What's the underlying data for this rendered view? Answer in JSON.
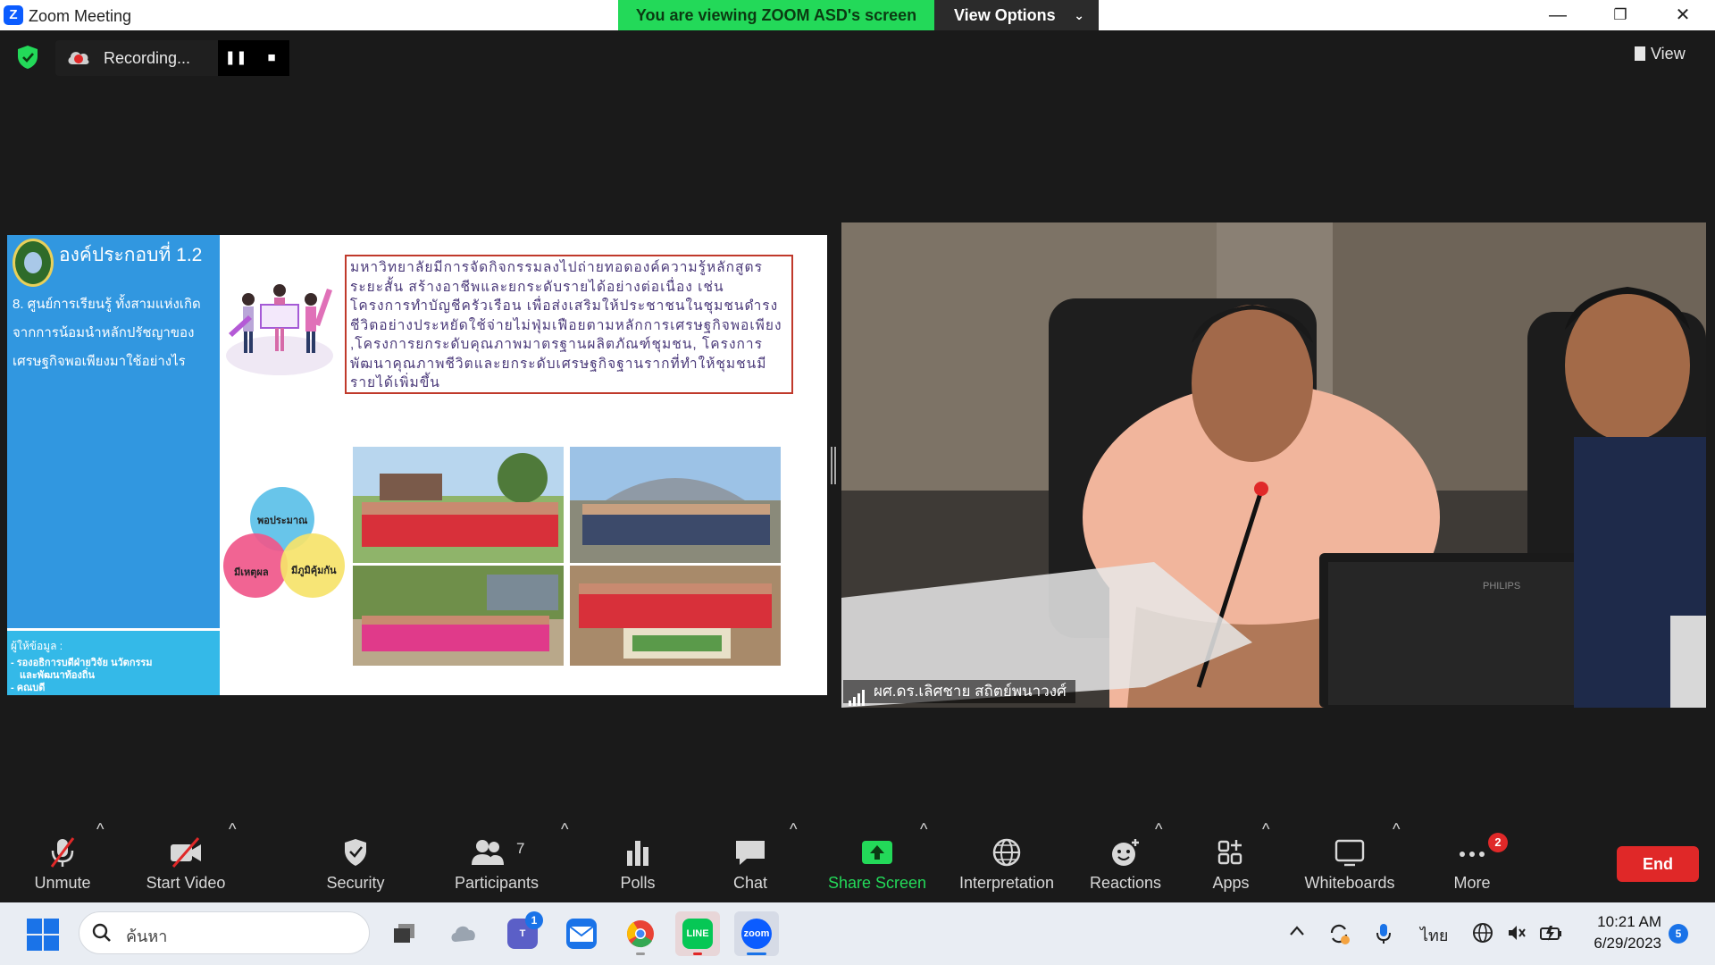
{
  "window": {
    "title": "Zoom Meeting",
    "app_icon_letter": "Z",
    "viewing_banner": "You are viewing ZOOM ASD's screen",
    "view_options_label": "View Options",
    "minimize": "—",
    "restore": "❐",
    "close": "✕"
  },
  "recording": {
    "label": "Recording...",
    "pause": "❚❚",
    "stop": "■"
  },
  "top_right": {
    "view_label": "View"
  },
  "slide": {
    "component_title": "องค์ประกอบที่ 1.2",
    "question": "8. ศูนย์การเรียนรู้ ทั้งสามแห่งเกิดจากการน้อมนำหลักปรัชญาของเศรษฐกิจพอเพียงมาใช้อย่างไร",
    "body_text": "มหาวิทยาลัยมีการจัดกิจกรรมลงไปถ่ายทอดองค์ความรู้หลักสูตรระยะสั้น สร้างอาชีพและยกระดับรายได้อย่างต่อเนื่อง เช่น โครงการทำบัญชีครัวเรือน เพื่อส่งเสริมให้ประชาชนในชุมชนดำรงชีวิตอย่างประหยัดใช้จ่ายไม่ฟุ่มเฟือยตามหลักการเศรษฐกิจพอเพียง ,โครงการยกระดับคุณภาพมาตรฐานผลิตภัณฑ์ชุมชน, โครงการพัฒนาคุณภาพชีวิตและยกระดับเศรษฐกิจฐานรากที่ทำให้ชุมชนมีรายได้เพิ่มขึ้น",
    "provider_label": "ผู้ให้ข้อมูล :",
    "provider_lines": [
      "- รองอธิการบดีฝ่ายวิจัย นวัตกรรม",
      "  และพัฒนาท้องถิ่น",
      "- คณบดี"
    ],
    "venn": {
      "top": "พอประมาณ",
      "left": "มีเหตุผล",
      "right": "มีภูมิคุ้มกัน",
      "colors": {
        "top": "#5bc0e8",
        "left": "#f0578a",
        "right": "#f6e36a"
      }
    }
  },
  "video": {
    "participant_name": "ผศ.ดร.เลิศชาย สถิตย์พนาวงศ์"
  },
  "toolbar": {
    "unmute": "Unmute",
    "start_video": "Start Video",
    "security": "Security",
    "participants": "Participants",
    "participant_count": "7",
    "polls": "Polls",
    "chat": "Chat",
    "share_screen": "Share Screen",
    "interpretation": "Interpretation",
    "reactions": "Reactions",
    "apps": "Apps",
    "whiteboards": "Whiteboards",
    "more": "More",
    "more_badge": "2",
    "end": "End",
    "caret": "^",
    "colors": {
      "share": "#23d959",
      "end": "#e02828"
    }
  },
  "taskbar": {
    "search_placeholder": "ค้นหา",
    "teams_badge": "1",
    "zoom_label": "zoom",
    "line_label": "LINE",
    "language": "ไทย",
    "time": "10:21 AM",
    "date": "6/29/2023",
    "notification_count": "5"
  }
}
